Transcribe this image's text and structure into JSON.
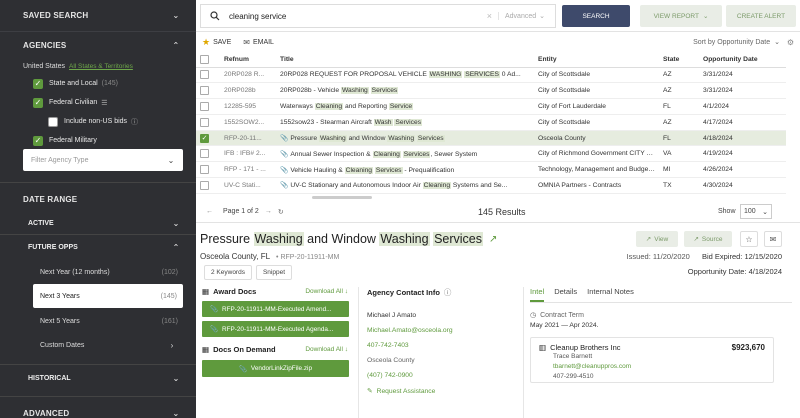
{
  "sidebar": {
    "saved_search": "SAVED SEARCH",
    "agencies": "AGENCIES",
    "country": "United States",
    "all_states_link": "All States & Territories",
    "checks": [
      {
        "label": "State and Local",
        "count": "(145)",
        "checked": true
      },
      {
        "label": "Federal Civilian",
        "count": "",
        "checked": true
      },
      {
        "label": "Include non-US bids",
        "count": "",
        "checked": false
      },
      {
        "label": "Federal Military",
        "count": "",
        "checked": true
      }
    ],
    "agency_type_placeholder": "Filter Agency Type",
    "date_range": "DATE RANGE",
    "active": "ACTIVE",
    "future_opps": "FUTURE OPPS",
    "options": [
      {
        "label": "Next Year (12 months)",
        "count": "(102)"
      },
      {
        "label": "Next 3 Years",
        "count": "(145)"
      },
      {
        "label": "Next 5 Years",
        "count": "(161)"
      },
      {
        "label": "Custom Dates",
        "count": ""
      }
    ],
    "historical": "HISTORICAL",
    "advanced": "ADVANCED"
  },
  "topbar": {
    "search_value": "cleaning service",
    "advanced": "Advanced",
    "search_button": "SEARCH",
    "view_report": "VIEW REPORT",
    "create_alert": "CREATE ALERT"
  },
  "actions": {
    "save": "SAVE",
    "email": "EMAIL",
    "sort": "Sort by Opportunity Date"
  },
  "table": {
    "headers": [
      "Refnum",
      "Title",
      "Entity",
      "State",
      "Opportunity Date"
    ],
    "rows": [
      {
        "ref": "20RP028 R...",
        "title": "20RP028 REQUEST FOR PROPOSAL VEHICLE WASHING SERVICES 0 Ad...",
        "entity": "City of Scottsdale",
        "state": "AZ",
        "date": "3/31/2024"
      },
      {
        "ref": "20RP028b",
        "title": "20RP028b - Vehicle Washing Services",
        "entity": "City of Scottsdale",
        "state": "AZ",
        "date": "3/31/2024"
      },
      {
        "ref": "12285-595",
        "title": "Waterways Cleaning and Reporting Service",
        "entity": "City of Fort Lauderdale",
        "state": "FL",
        "date": "4/1/2024"
      },
      {
        "ref": "1552SOW2...",
        "title": "1552sow23 - Stearman Aircraft Wash Services",
        "entity": "City of Scottsdale",
        "state": "AZ",
        "date": "4/17/2024"
      },
      {
        "ref": "RFP-20-11...",
        "title": "Pressure Washing and Window Washing Services",
        "entity": "Osceola County",
        "state": "FL",
        "date": "4/18/2024"
      },
      {
        "ref": "IFB : IFB# 2...",
        "title": "Annual Sewer Inspection & Cleaning Services, Sewer System",
        "entity": "City of Richmond Government CITY OF R...",
        "state": "VA",
        "date": "4/19/2024"
      },
      {
        "ref": "RFP - 171 - ...",
        "title": "Vehicle Hauling & Cleaning Services - Prequalification",
        "entity": "Technology, Management and Budget De...",
        "state": "MI",
        "date": "4/26/2024"
      },
      {
        "ref": "UV-C Stati...",
        "title": "UV-C Stationary and Autonomous Indoor Air Cleaning Systems and Se...",
        "entity": "OMNIA Partners - Contracts",
        "state": "TX",
        "date": "4/30/2024"
      }
    ]
  },
  "pager": {
    "page": "Page 1 of 2",
    "total": "145 Results",
    "show": "Show",
    "show_value": "100"
  },
  "detail": {
    "title": "Pressure Washing and Window Washing Services",
    "view": "View",
    "source": "Source",
    "county": "Osceola County, FL",
    "rfp": "RFP-20-11911-MM",
    "issued": "Issued: 11/20/2020",
    "bid_expired": "Bid Expired: 12/15/2020",
    "opp_date": "Opportunity Date: 4/18/2024",
    "tab_keywords": "2 Keywords",
    "tab_snippet": "Snippet",
    "award_docs": "Award Docs",
    "download_all": "Download All",
    "docs": [
      "RFP-20-11911-MM-Executed Amend...",
      "RFP-20-11911-MM-Executed Agenda..."
    ],
    "docs_on_demand": "Docs On Demand",
    "zip": "VendorLinkZipFile.zip",
    "contact_head": "Agency Contact Info",
    "contact": {
      "name": "Michael J Amato",
      "email": "Michael.Amato@osceola.org",
      "phone": "407-742-7403",
      "county": "Osceola County",
      "phone2": "(407) 742-0900"
    },
    "request_assistance": "Request Assistance",
    "right_tabs": [
      "Intel",
      "Details",
      "Internal Notes"
    ],
    "contract_term_label": "Contract Term",
    "contract_term": "May 2021 — Apr 2024.",
    "award": {
      "company": "Cleanup Brothers Inc",
      "amount": "$923,670",
      "person": "Trace Barnett",
      "email": "tbarnett@cleanuppros.com",
      "phone": "407-299-4510"
    }
  },
  "colors": {
    "accent": "#5f9a3d",
    "sidebar": "#2e2f33",
    "search_btn": "#3e4a6b"
  }
}
